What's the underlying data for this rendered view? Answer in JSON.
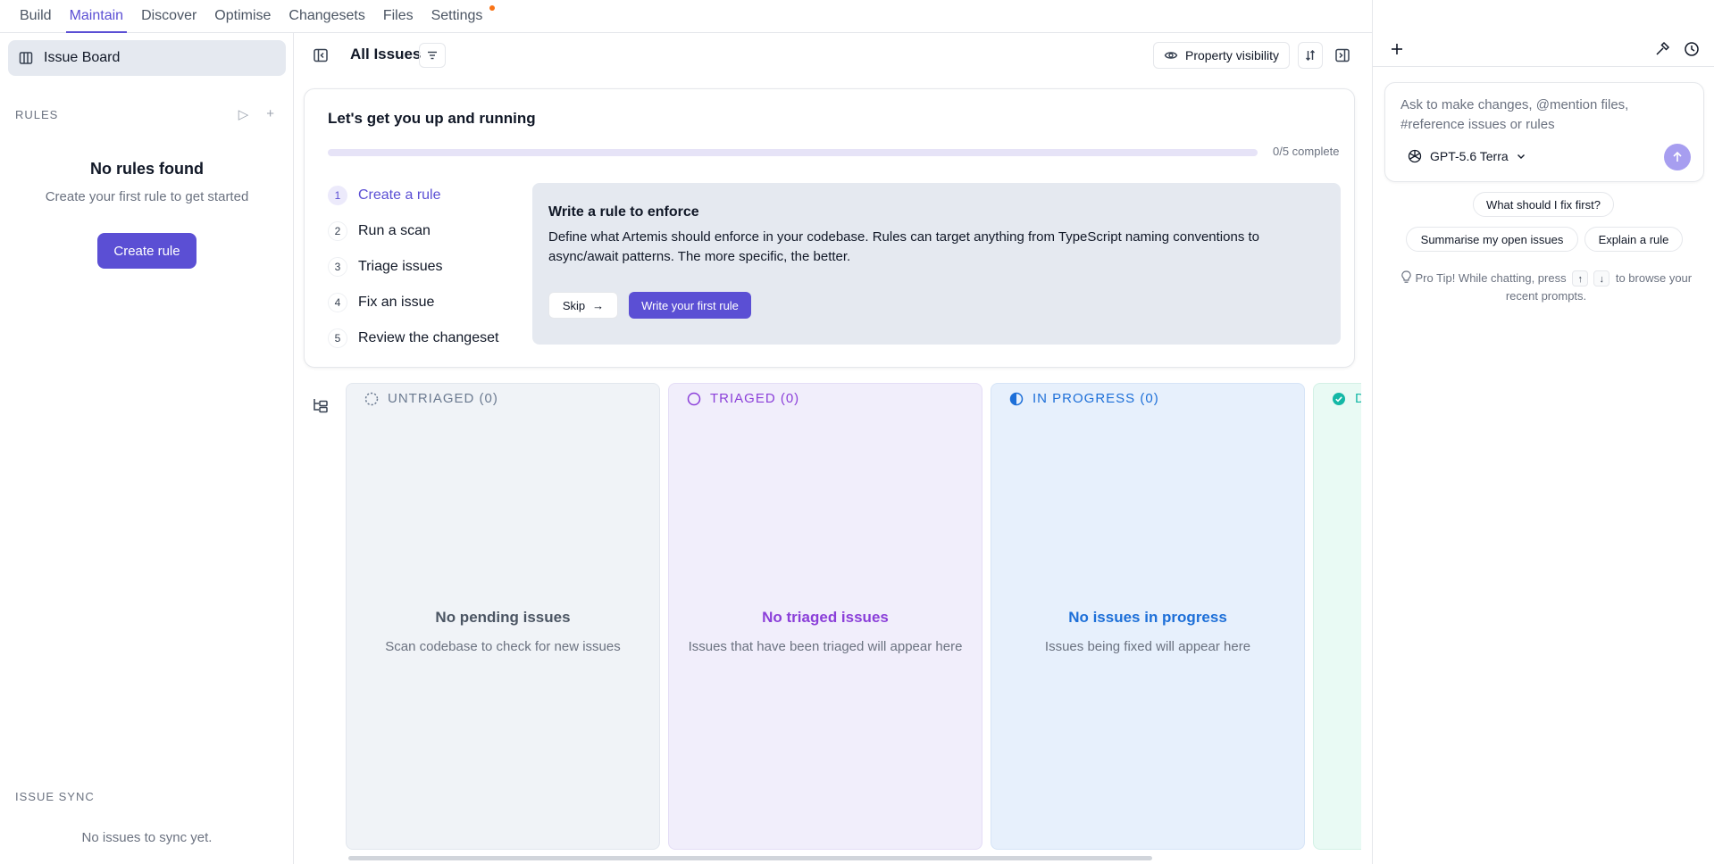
{
  "nav": {
    "tabs": [
      {
        "label": "Build"
      },
      {
        "label": "Maintain"
      },
      {
        "label": "Discover"
      },
      {
        "label": "Optimise"
      },
      {
        "label": "Changesets"
      },
      {
        "label": "Files"
      },
      {
        "label": "Settings"
      }
    ],
    "active_tab": "Maintain"
  },
  "sidebar": {
    "issue_board_label": "Issue Board",
    "rules_label": "RULES",
    "empty_title": "No rules found",
    "empty_subtitle": "Create your first rule to get started",
    "create_rule_label": "Create rule",
    "issue_sync_label": "ISSUE SYNC",
    "issue_sync_empty": "No issues to sync yet."
  },
  "toolbar": {
    "title": "All Issues",
    "property_visibility_label": "Property visibility"
  },
  "onboarding": {
    "title": "Let's get you up and running",
    "progress_fraction": 0,
    "progress_label": "0/5 complete",
    "steps": [
      {
        "num": "1",
        "label": "Create a rule"
      },
      {
        "num": "2",
        "label": "Run a scan"
      },
      {
        "num": "3",
        "label": "Triage issues"
      },
      {
        "num": "4",
        "label": "Fix an issue"
      },
      {
        "num": "5",
        "label": "Review the changeset"
      }
    ],
    "active_step": 0,
    "card": {
      "heading": "Write a rule to enforce",
      "body": "Define what Artemis should enforce in your codebase. Rules can target anything from TypeScript naming conventions to async/await patterns. The more specific, the better.",
      "skip_label": "Skip",
      "write_label": "Write your first rule"
    }
  },
  "board": {
    "columns": [
      {
        "title": "UNTRIAGED (0)",
        "empty_title": "No pending issues",
        "empty_subtitle": "Scan codebase to check for new issues"
      },
      {
        "title": "TRIAGED (0)",
        "empty_title": "No triaged issues",
        "empty_subtitle": "Issues that have been triaged will appear here"
      },
      {
        "title": "IN PROGRESS (0)",
        "empty_title": "No issues in progress",
        "empty_subtitle": "Issues being fixed will appear here"
      },
      {
        "title": "D",
        "empty_title": "",
        "empty_subtitle": ""
      }
    ]
  },
  "chat": {
    "placeholder": "Ask to make changes, @mention files, #reference issues or rules",
    "model_label": "GPT-5.6 Terra",
    "suggestions": [
      {
        "label": "What should I fix first?"
      },
      {
        "label": "Summarise my open issues"
      },
      {
        "label": "Explain a rule"
      }
    ],
    "pro_tip_prefix": "Pro Tip! While chatting, press",
    "pro_tip_key_up": "↑",
    "pro_tip_key_down": "↓",
    "pro_tip_suffix": "to browse your recent prompts."
  },
  "colors": {
    "accent": "#5b4fd4",
    "untriaged": "#6b7a90",
    "triaged": "#8b3fd9",
    "in_progress": "#1d6fd8",
    "done": "#14b8a6"
  }
}
